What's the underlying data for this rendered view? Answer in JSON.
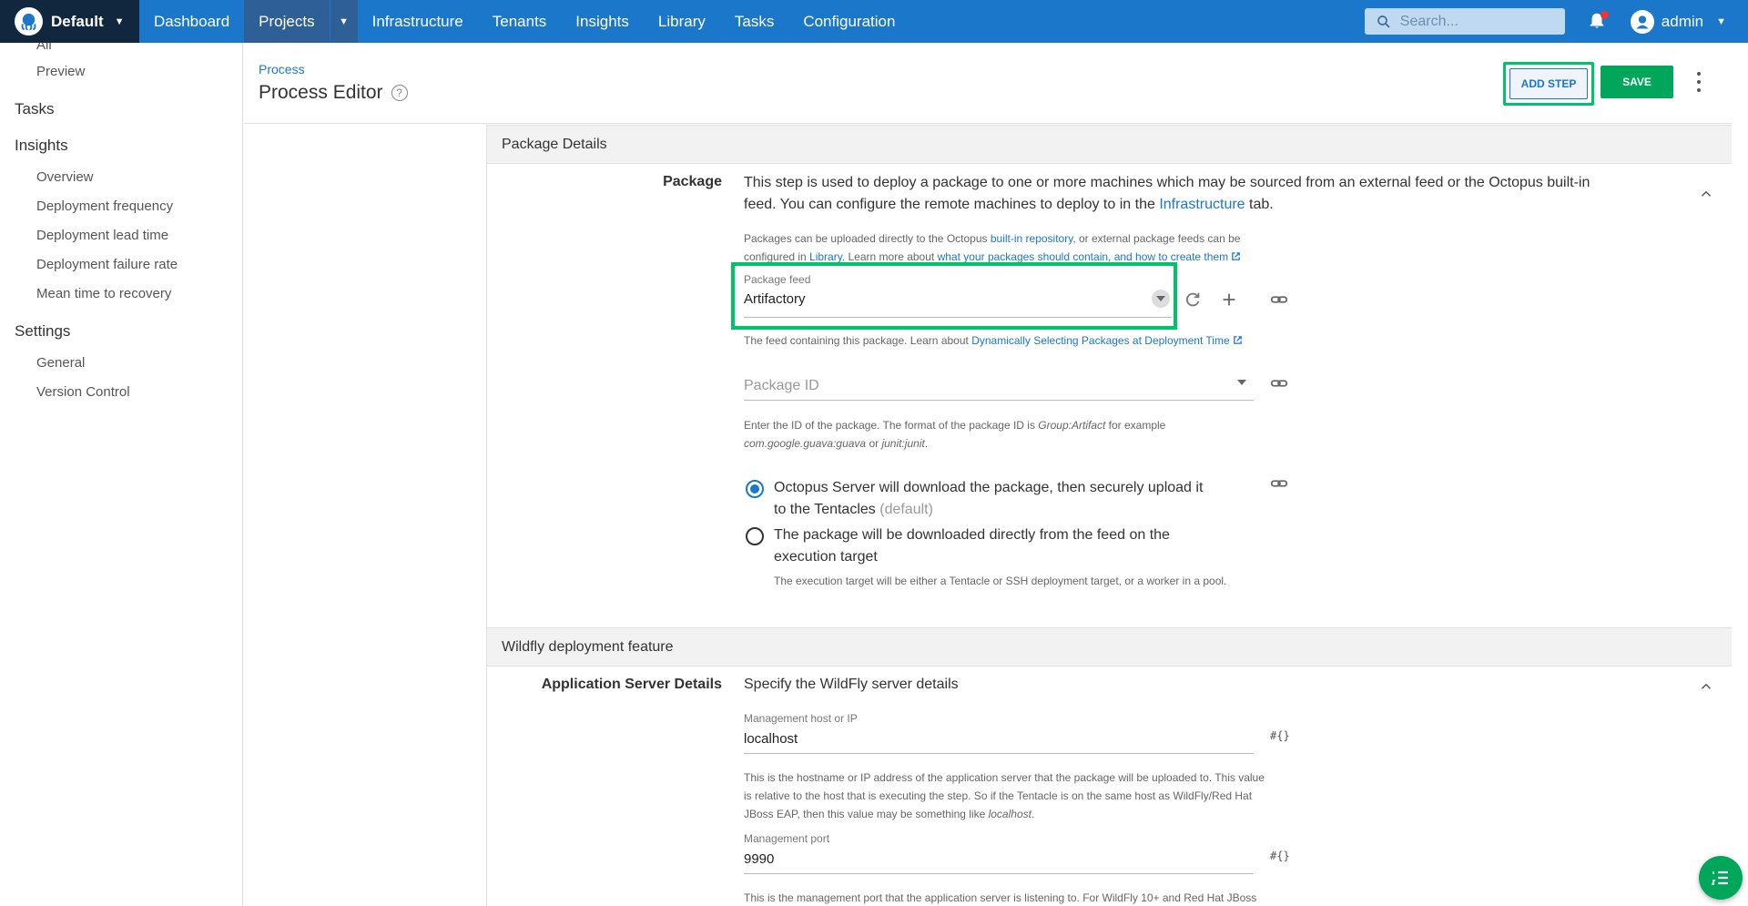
{
  "topnav": {
    "space_name": "Default",
    "items": [
      "Dashboard",
      "Projects",
      "Infrastructure",
      "Tenants",
      "Insights",
      "Library",
      "Tasks",
      "Configuration"
    ],
    "search_placeholder": "Search...",
    "user_name": "admin"
  },
  "sidebar": {
    "partial_item": "All",
    "preview": "Preview",
    "tasks": "Tasks",
    "insights": "Insights",
    "insights_items": [
      "Overview",
      "Deployment frequency",
      "Deployment lead time",
      "Deployment failure rate",
      "Mean time to recovery"
    ],
    "settings": "Settings",
    "settings_items": [
      "General",
      "Version Control"
    ]
  },
  "header": {
    "breadcrumb": "Process",
    "title": "Process Editor",
    "help": "?",
    "add_step": "ADD STEP",
    "save": "SAVE"
  },
  "package_section": {
    "title": "Package Details",
    "label": "Package",
    "desc_1": "This step is used to deploy a package to one or more machines which may be sourced from an external feed or the Octopus built-in",
    "desc_2_pre": "feed. You can configure the remote machines to deploy to in the ",
    "desc_2_link": "Infrastructure",
    "desc_2_post": " tab.",
    "upload_pre": "Packages can be uploaded directly to the Octopus ",
    "upload_link1": "built-in repository",
    "upload_mid": ", or external package feeds can be",
    "upload_line2_pre": "configured in ",
    "upload_link2": "Library",
    "upload_line2_mid": ". Learn more about ",
    "upload_link3": "what your packages should contain, and how to create them",
    "feed_label": "Package feed",
    "feed_value": "Artifactory",
    "feed_help_pre": "The feed containing this package. Learn about ",
    "feed_help_link": "Dynamically Selecting Packages at Deployment Time",
    "package_id_placeholder": "Package ID",
    "pkgid_help_1_pre": "Enter the ID of the package. The format of the package ID is ",
    "pkgid_help_1_em": "Group:Artifact",
    "pkgid_help_1_post": " for example",
    "pkgid_help_2_em1": "com.google.guava:guava",
    "pkgid_help_2_mid": " or ",
    "pkgid_help_2_em2": "junit:junit",
    "pkgid_help_2_post": ".",
    "radio_1_line1": "Octopus Server will download the package, then securely upload it",
    "radio_1_line2": "to the Tentacles ",
    "radio_1_default": "(default)",
    "radio_2_line1": "The package will be downloaded directly from the feed on the",
    "radio_2_line2": "execution target",
    "radio_2_help": "The execution target will be either a Tentacle or SSH deployment target, or a worker in a pool."
  },
  "wildfly_section": {
    "title": "Wildfly deployment feature",
    "label": "Application Server Details",
    "desc": "Specify the WildFly server details",
    "host_label": "Management host or IP",
    "host_value": "localhost",
    "host_help_1": "This is the hostname or IP address of the application server that the package will be uploaded to. This value",
    "host_help_2": "is relative to the host that is executing the step. So if the Tentacle is on the same host as WildFly/Red Hat",
    "host_help_3_pre": "JBoss EAP, then this value may be something like ",
    "host_help_3_em": "localhost",
    "host_help_3_post": ".",
    "port_label": "Management port",
    "port_value": "9990",
    "port_help": "This is the management port that the application server is listening to. For WildFly 10+ and Red Hat JBoss",
    "var_symbol": "#{}"
  },
  "colors": {
    "nav_blue": "#1a77ca",
    "nav_dark": "#10273d",
    "highlight_green": "#00c26a",
    "save_green": "#00a65a"
  },
  "icons": [
    "octopus-logo-icon",
    "search-icon",
    "bell-icon",
    "user-avatar-icon",
    "help-icon",
    "chevron-up-icon",
    "refresh-icon",
    "plus-icon",
    "link-icon",
    "external-link-icon",
    "task-list-icon"
  ]
}
